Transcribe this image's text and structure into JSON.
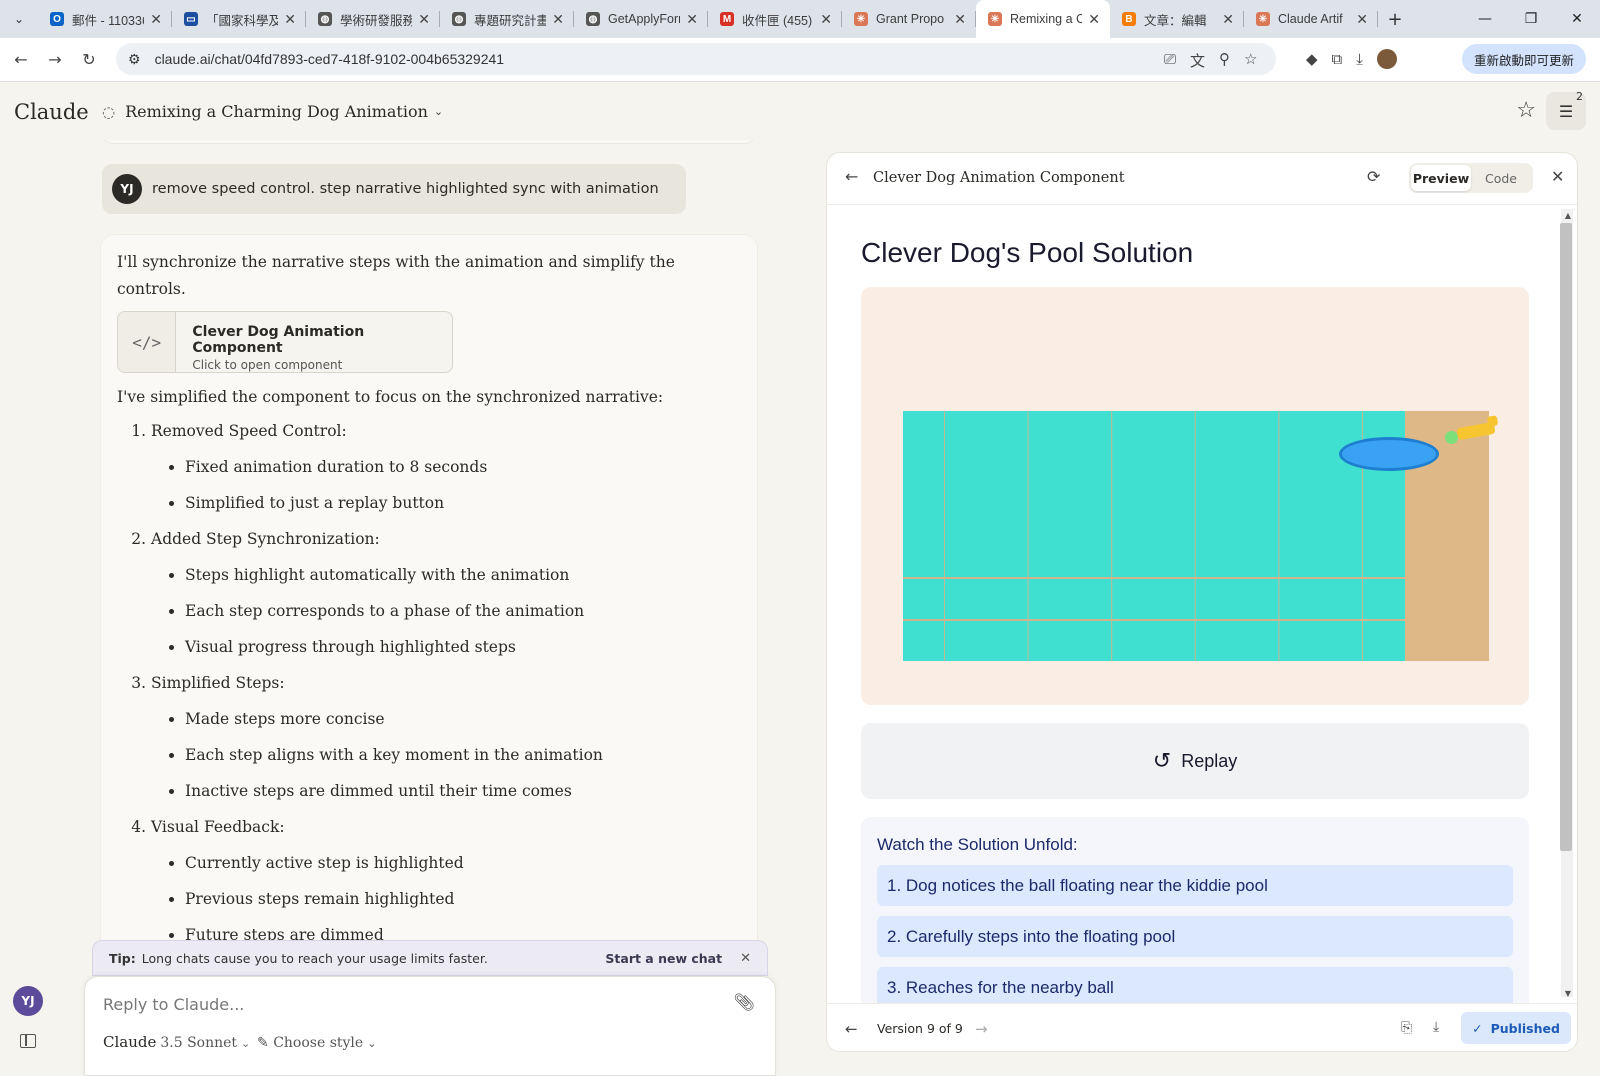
{
  "browser": {
    "tabs": [
      {
        "title": "郵件 - 110336",
        "fav_color": "#0a64c8",
        "fav": "O"
      },
      {
        "title": "「國家科學及",
        "fav_color": "#1d4fa0",
        "fav": "▭"
      },
      {
        "title": "學術研發服務",
        "fav_color": "#555555",
        "fav": "◍"
      },
      {
        "title": "專題研究計畫",
        "fav_color": "#555555",
        "fav": "◍"
      },
      {
        "title": "GetApplyForm",
        "fav_color": "#555555",
        "fav": "◍"
      },
      {
        "title": "收件匣 (455)",
        "fav_color": "#d93025",
        "fav": "M"
      },
      {
        "title": "Grant Propo",
        "fav_color": "#d97757",
        "fav": "✳"
      },
      {
        "title": "Remixing a C",
        "fav_color": "#d97757",
        "fav": "✳"
      },
      {
        "title": "文章：編輯",
        "fav_color": "#f57c00",
        "fav": "B"
      },
      {
        "title": "Claude Artif",
        "fav_color": "#d97757",
        "fav": "✳"
      }
    ],
    "active_tab_index": 7,
    "url": "claude.ai/chat/04fd7893-ced7-418f-9102-004b65329241",
    "update_button": "重新啟動即可更新"
  },
  "app": {
    "logo": "Claude",
    "conversation_title": "Remixing a Charming Dog Animation",
    "settings_badge": "2"
  },
  "chat": {
    "user_avatar": "YJ",
    "user_message": "remove speed control. step narrative highlighted sync with animation",
    "ai_intro": "I'll synchronize the narrative steps with the animation and simplify the controls.",
    "artifact_card": {
      "icon": "</>",
      "title": "Clever Dog Animation Component",
      "subtitle": "Click to open component"
    },
    "ai_summary": "I've simplified the component to focus on the synchronized narrative:",
    "sections": [
      {
        "title": "Removed Speed Control:",
        "items": [
          "Fixed animation duration to 8 seconds",
          "Simplified to just a replay button"
        ]
      },
      {
        "title": "Added Step Synchronization:",
        "items": [
          "Steps highlight automatically with the animation",
          "Each step corresponds to a phase of the animation",
          "Visual progress through highlighted steps"
        ]
      },
      {
        "title": "Simplified Steps:",
        "items": [
          "Made steps more concise",
          "Each step aligns with a key moment in the animation",
          "Inactive steps are dimmed until their time comes"
        ]
      },
      {
        "title": "Visual Feedback:",
        "items": [
          "Currently active step is highlighted",
          "Previous steps remain highlighted",
          "Future steps are dimmed"
        ]
      }
    ]
  },
  "tip": {
    "label": "Tip:",
    "text": "Long chats cause you to reach your usage limits faster.",
    "action": "Start a new chat"
  },
  "composer": {
    "placeholder": "Reply to Claude...",
    "model": "Claude",
    "model_version": "3.5 Sonnet",
    "style": "Choose style"
  },
  "sidebar": {
    "avatar": "YJ"
  },
  "artifact": {
    "title": "Clever Dog Animation Component",
    "tabs": {
      "preview": "Preview",
      "code": "Code"
    },
    "active_tab": "preview",
    "demo_title": "Clever Dog's Pool Solution",
    "replay": "Replay",
    "steps_title": "Watch the Solution Unfold:",
    "steps": [
      "1. Dog notices the ball floating near the kiddie pool",
      "2. Carefully steps into the floating pool",
      "3. Reaches for the nearby ball"
    ],
    "version": "Version 9 of 9",
    "publish": "Published"
  }
}
